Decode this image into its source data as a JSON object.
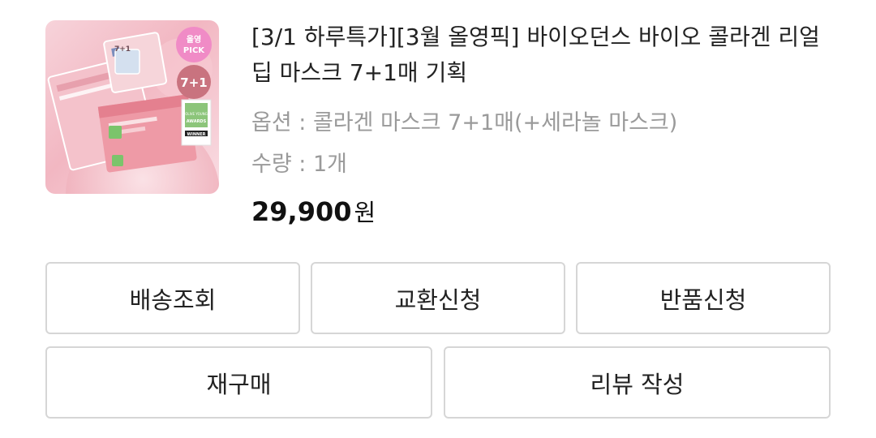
{
  "product": {
    "image_alt": "바이오던스 바이오 콜라겐 리얼 딥 마스크 7+1매",
    "image_badges": {
      "pick_line1": "올영",
      "pick_line2": "PICK",
      "count": "7+1",
      "corner_count": "7+1",
      "award_line1": "OLIVE YOUNG",
      "award_line2": "AWARDS",
      "award_winner": "WINNER"
    },
    "title": "[3/1 하루특가][3월 올영픽] 바이오던스 바이오 콜라겐 리얼 딥 마스크 7+1매 기획",
    "option": "옵션 : 콜라겐 마스크 7+1매(+세라놀 마스크)",
    "quantity": "수량 : 1개",
    "price": "29,900",
    "currency": "원"
  },
  "actions": {
    "track_delivery": "배송조회",
    "exchange_request": "교환신청",
    "return_request": "반품신청",
    "reorder": "재구매",
    "write_review": "리뷰 작성"
  },
  "colors": {
    "thumb_pink": "#f2b7c2",
    "badge_pick": "#f08bc6",
    "badge_count": "#c9737f",
    "button_border": "#d6d6d6"
  }
}
